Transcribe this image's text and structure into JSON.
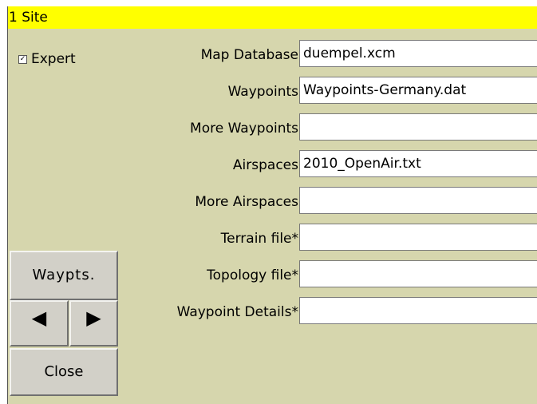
{
  "window": {
    "title": "1 Site"
  },
  "expert": {
    "label": "Expert",
    "checked": true
  },
  "fields": [
    {
      "label": "Map Database",
      "value": "duempel.xcm"
    },
    {
      "label": "Waypoints",
      "value": "Waypoints-Germany.dat"
    },
    {
      "label": "More Waypoints",
      "value": ""
    },
    {
      "label": "Airspaces",
      "value": "2010_OpenAir.txt"
    },
    {
      "label": "More Airspaces",
      "value": ""
    },
    {
      "label": "Terrain file*",
      "value": ""
    },
    {
      "label": "Topology file*",
      "value": ""
    },
    {
      "label": "Waypoint Details*",
      "value": ""
    }
  ],
  "buttons": {
    "waypts": "Waypts.",
    "prev": "◀",
    "next": "▶",
    "close": "Close"
  }
}
